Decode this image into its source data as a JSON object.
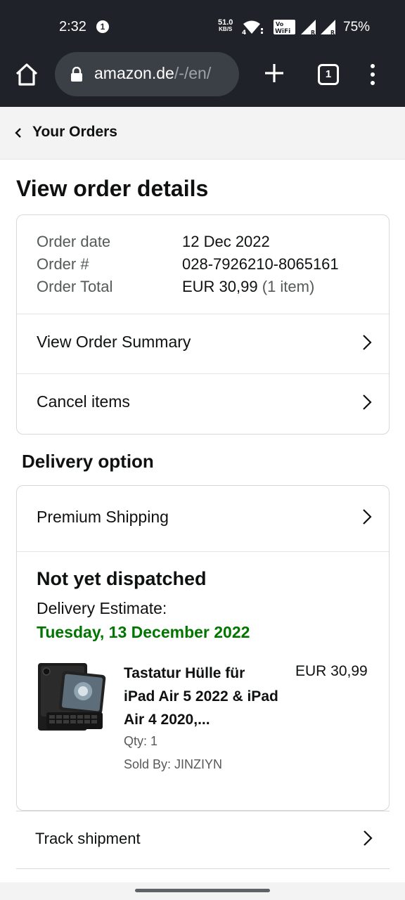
{
  "status_bar": {
    "time": "2:32",
    "notification_count": "1",
    "net_speed_value": "51.0",
    "net_speed_unit": "KB/S",
    "battery": "75%"
  },
  "browser": {
    "url_host": "amazon.de",
    "url_path": "/-/en/",
    "tab_count": "1"
  },
  "breadcrumb": {
    "label": "Your Orders"
  },
  "page": {
    "title": "View order details"
  },
  "order": {
    "rows": [
      {
        "key": "Order date",
        "value": "12 Dec 2022",
        "extra": ""
      },
      {
        "key": "Order #",
        "value": "028-7926210-8065161",
        "extra": ""
      },
      {
        "key": "Order Total",
        "value": "EUR 30,99",
        "extra": "(1 item)"
      }
    ],
    "links": {
      "summary": "View Order Summary",
      "cancel": "Cancel items"
    }
  },
  "delivery": {
    "section_title": "Delivery option",
    "shipping_method": "Premium Shipping",
    "status": "Not yet dispatched",
    "estimate_label": "Delivery Estimate:",
    "estimate_date": "Tuesday, 13 December 2022",
    "estimate_color": "#007600"
  },
  "product": {
    "name": "Tastatur Hülle für iPad Air 5 2022 & iPad Air 4 2020,...",
    "price": "EUR 30,99",
    "qty": "Qty: 1",
    "seller": "Sold By: JINZIYN",
    "image_icon": "tablet-keyboard-case-image"
  },
  "tracking": {
    "label": "Track shipment"
  }
}
